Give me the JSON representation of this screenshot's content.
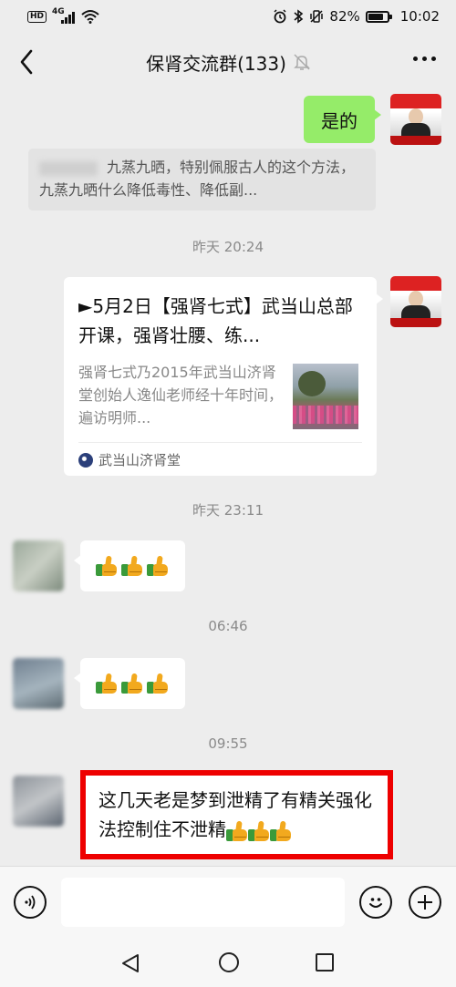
{
  "status_bar": {
    "hd": "HD",
    "network": "4G",
    "battery": "82%",
    "battery_level": 0.82,
    "time": "10:02"
  },
  "header": {
    "title": "保肾交流群(133)"
  },
  "messages": {
    "reply_self": "是的",
    "quote_text": "九蒸九晒，特别佩服古人的这个方法，九蒸九晒什么降低毒性、降低副...",
    "time1": "昨天 20:24",
    "card": {
      "title": "►5月2日【强肾七式】武当山总部开课，强肾壮腰、练...",
      "description": "强肾七式乃2015年武当山济肾堂创始人逸仙老师经十年时间，遍访明师...",
      "source": "武当山济肾堂"
    },
    "time2": "昨天 23:11",
    "time3": "06:46",
    "time4": "09:55",
    "last_text": "这几天老是梦到泄精了有精关强化法控制住不泄精"
  },
  "input": {
    "value": ""
  },
  "colors": {
    "green_bubble": "#95ec69",
    "highlight_border": "#e00000",
    "background": "#ededed"
  },
  "icons": [
    "back-arrow-icon",
    "mute-bell-icon",
    "more-icon",
    "voice-icon",
    "emoji-icon",
    "plus-icon",
    "thumbs-up-icon",
    "nav-back-icon",
    "nav-home-icon",
    "nav-recent-icon"
  ]
}
